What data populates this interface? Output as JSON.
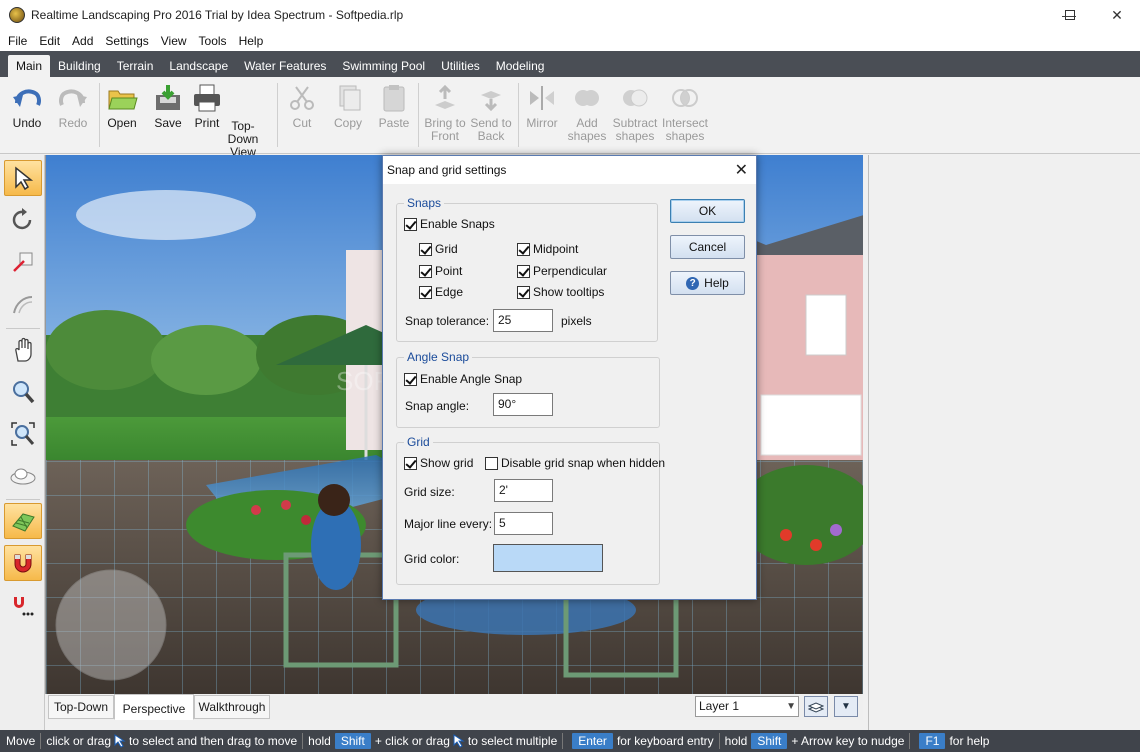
{
  "window": {
    "title": "Realtime Landscaping Pro 2016 Trial by Idea Spectrum - Softpedia.rlp",
    "controls": [
      "minimize-icon",
      "maximize-icon",
      "close-icon"
    ]
  },
  "menu": [
    "File",
    "Edit",
    "Add",
    "Settings",
    "View",
    "Tools",
    "Help"
  ],
  "ribbon_tabs": [
    {
      "label": "Main",
      "active": true
    },
    {
      "label": "Building"
    },
    {
      "label": "Terrain"
    },
    {
      "label": "Landscape"
    },
    {
      "label": "Water Features"
    },
    {
      "label": "Swimming Pool"
    },
    {
      "label": "Utilities"
    },
    {
      "label": "Modeling"
    }
  ],
  "toolbar": {
    "undo": "Undo",
    "redo": "Redo",
    "open": "Open",
    "save": "Save",
    "print": "Print",
    "top_down_view": "Top-Down\nView",
    "cut": "Cut",
    "copy": "Copy",
    "paste": "Paste",
    "bring_to_front": "Bring to\nFront",
    "send_to_back": "Send to\nBack",
    "mirror": "Mirror",
    "add_shapes": "Add\nshapes",
    "subtract_shapes": "Subtract\nshapes",
    "intersect_shapes": "Intersect\nshapes"
  },
  "left_tools": [
    "select-arrow-icon",
    "rotate-icon",
    "measure-icon",
    "curve-icon",
    "pan-hand-icon",
    "zoom-icon",
    "zoom-extents-icon",
    "cloud-icon",
    "grid-toggle-icon",
    "snap-magnet-icon",
    "snap-settings-icon"
  ],
  "view_tabs": [
    {
      "label": "Top-Down"
    },
    {
      "label": "Perspective",
      "active": true
    },
    {
      "label": "Walkthrough"
    }
  ],
  "layer": {
    "selected": "Layer 1"
  },
  "viewport": {
    "watermark": "SOFTPEDIA"
  },
  "statusbar": {
    "mode": "Move",
    "hint1": "click or drag",
    "hint2": "to select and then drag to move",
    "hold1": "hold",
    "key_shift1": "Shift",
    "hint3": "+ click or drag",
    "hint4": "to select multiple",
    "key_enter": "Enter",
    "hint5": "for keyboard entry",
    "hold2": "hold",
    "key_shift2": "Shift",
    "hint6": "+ Arrow key to nudge",
    "key_f1": "F1",
    "hint7": "for help"
  },
  "dialog": {
    "title": "Snap and grid settings",
    "ok": "OK",
    "cancel": "Cancel",
    "help": "Help",
    "snaps": {
      "legend": "Snaps",
      "enable_snaps": {
        "label": "Enable Snaps",
        "checked": true
      },
      "grid": {
        "label": "Grid",
        "checked": true
      },
      "midpoint": {
        "label": "Midpoint",
        "checked": true
      },
      "point": {
        "label": "Point",
        "checked": true
      },
      "perpendicular": {
        "label": "Perpendicular",
        "checked": true
      },
      "edge": {
        "label": "Edge",
        "checked": true
      },
      "show_tooltips": {
        "label": "Show tooltips",
        "checked": true
      },
      "tolerance_label": "Snap tolerance:",
      "tolerance_value": "25",
      "tolerance_unit": "pixels"
    },
    "angle_snap": {
      "legend": "Angle Snap",
      "enable": {
        "label": "Enable Angle Snap",
        "checked": true
      },
      "angle_label": "Snap angle:",
      "angle_value": "90°"
    },
    "grid": {
      "legend": "Grid",
      "show_grid": {
        "label": "Show grid",
        "checked": true
      },
      "disable_hidden": {
        "label": "Disable grid snap when hidden",
        "checked": false
      },
      "size_label": "Grid size:",
      "size_value": "2'",
      "major_label": "Major line every:",
      "major_value": "5",
      "color_label": "Grid color:",
      "color_value": "#b9d9f7"
    }
  }
}
